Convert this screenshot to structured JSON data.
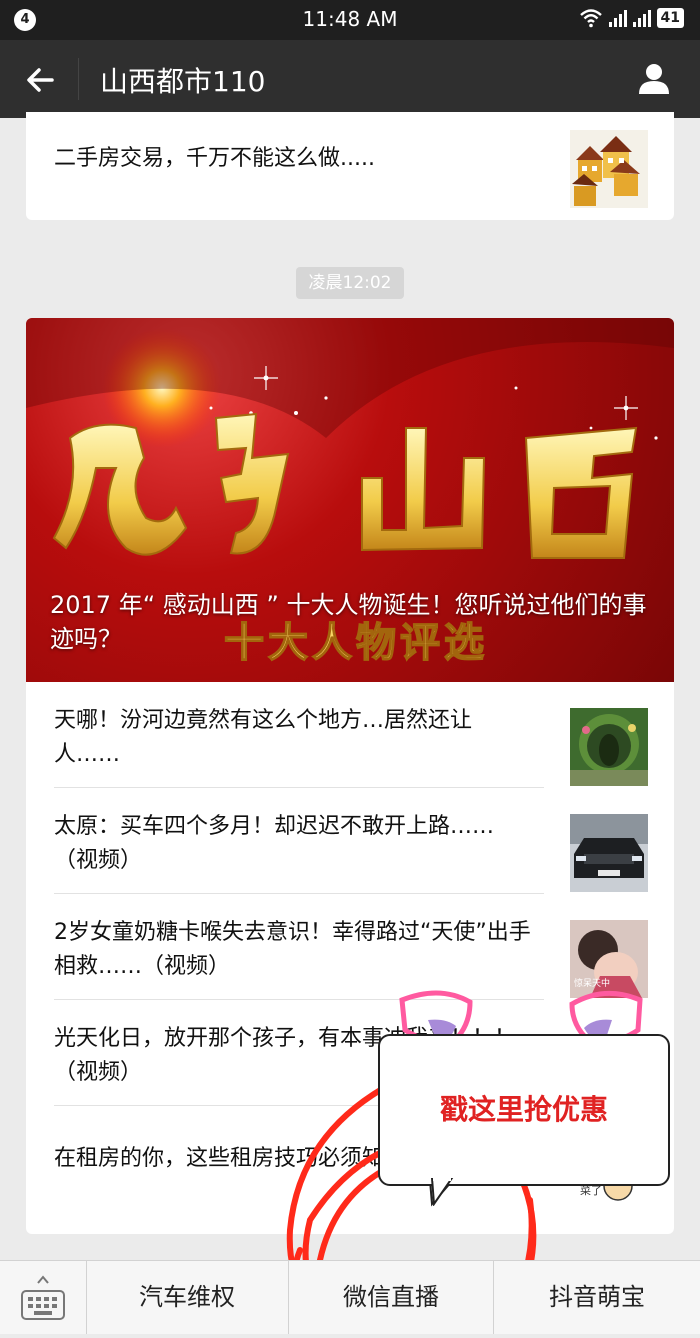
{
  "status_bar": {
    "notification_count": "4",
    "time": "11:48 AM",
    "battery": "41"
  },
  "header": {
    "title": "山西都市110"
  },
  "top_article": {
    "title": "二手房交易，千万不能这么做....."
  },
  "timestamp": "凌晨12:02",
  "featured": {
    "title": "2017 年“ 感动山西 ” 十大人物诞生！您听说过他们的事迹吗？"
  },
  "articles": [
    {
      "title": "天哪！汾河边竟然有这么个地方…居然还让人……"
    },
    {
      "title": "太原：买车四个多月！却迟迟不敢开上路……（视频）"
    },
    {
      "title": "2岁女童奶糖卡喉失去意识！幸得路过“天使”出手相救……（视频）"
    },
    {
      "title": "光天化日，放开那个孩子，有本事冲我来！！！（视频）"
    },
    {
      "title": "在租房的你，这些租房技巧必须知道！"
    }
  ],
  "promo": {
    "text": "戳这里抢优惠"
  },
  "bottom_menu": {
    "items": [
      "汽车维权",
      "微信直播",
      "抖音萌宝"
    ]
  },
  "colors": {
    "nav_bg": "#2f2f2f",
    "promo_red": "#e02222",
    "circle_red": "#ff2a1a"
  }
}
